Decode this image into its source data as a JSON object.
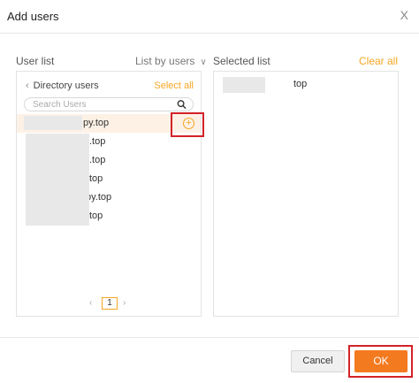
{
  "dialog": {
    "title": "Add users",
    "close_label": "X"
  },
  "left": {
    "heading": "User list",
    "view_mode": "List by users",
    "directory_label": "Directory users",
    "select_all": "Select all",
    "search_placeholder": "Search Users",
    "users": [
      {
        "suffix": "py.top"
      },
      {
        "suffix": ".top"
      },
      {
        "suffix": ".top"
      },
      {
        "suffix": "top"
      },
      {
        "suffix": "py.top"
      },
      {
        "suffix": "top"
      }
    ],
    "pagination": {
      "prev": "‹",
      "page": "1",
      "next": "›"
    }
  },
  "right": {
    "heading": "Selected list",
    "clear_all": "Clear all",
    "selected": [
      {
        "suffix": "top"
      }
    ]
  },
  "footer": {
    "cancel_label": "Cancel",
    "ok_label": "OK"
  },
  "colors": {
    "accent": "#f5a623",
    "ok_button": "#f47a20",
    "highlight_border": "#d32229",
    "row_highlight": "#fdf1e6"
  }
}
